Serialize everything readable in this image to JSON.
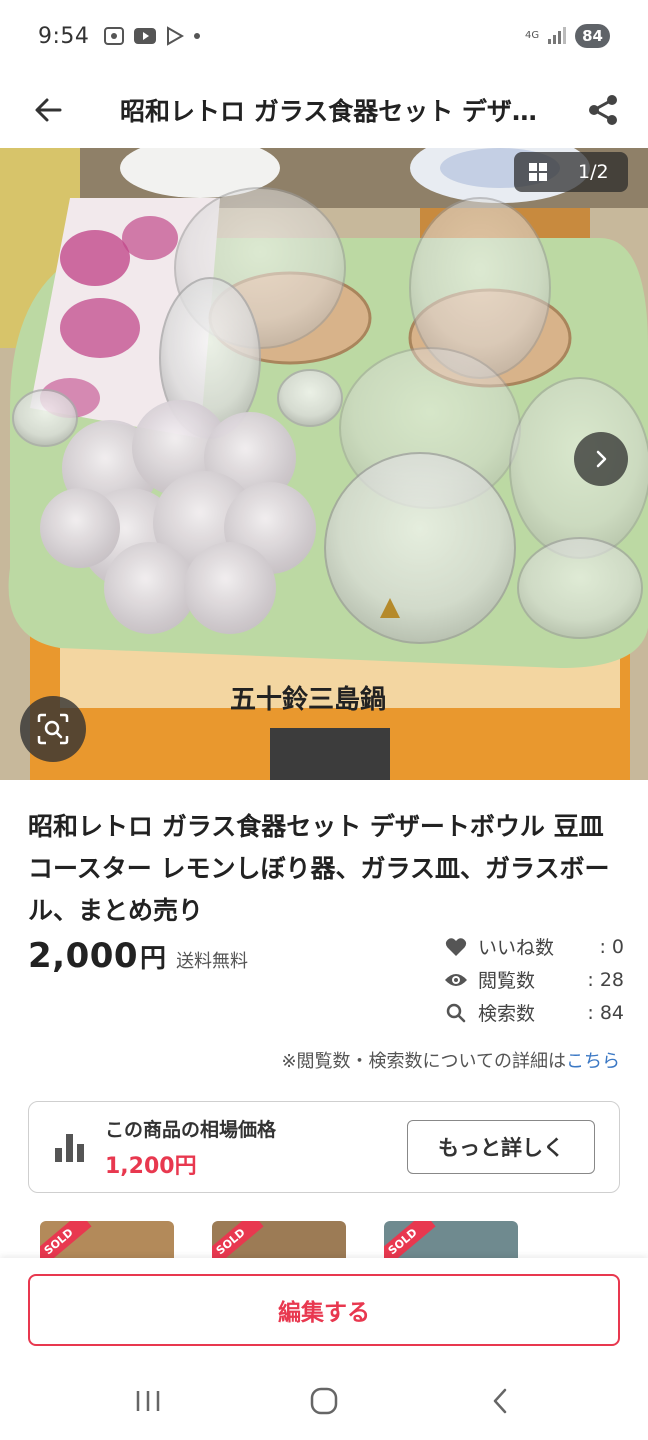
{
  "status_bar": {
    "time": "9:54",
    "network": "4G",
    "battery": "84"
  },
  "header": {
    "title": "昭和レトロ ガラス食器セット デザートボウル 豆皿 コースター レモンしぼり器、ガラス皿、ガラスボール、まとめ売り",
    "back_icon": "arrow-left-icon",
    "share_icon": "share-icon"
  },
  "gallery": {
    "counter": "1/2",
    "box_text": "五十鈴三島鍋"
  },
  "item": {
    "title": "昭和レトロ ガラス食器セット デザートボウル 豆皿 コースター レモンしぼり器、ガラス皿、ガラスボール、まとめ売り",
    "price": "2,000",
    "currency": "円",
    "shipping": "送料無料"
  },
  "stats": [
    {
      "icon": "heart-icon",
      "label": "いいね数",
      "value": ": 0"
    },
    {
      "icon": "eye-icon",
      "label": "閲覧数",
      "value": ": 28"
    },
    {
      "icon": "search-icon",
      "label": "検索数",
      "value": ": 84"
    }
  ],
  "note": {
    "text": "※閲覧数・検索数についての詳細は",
    "link": "こちら"
  },
  "market": {
    "label": "この商品の相場価格",
    "price": "1,200円",
    "button": "もっと詳しく"
  },
  "similar": {
    "badge": "SOLD"
  },
  "bottom": {
    "edit_button": "編集する"
  },
  "colors": {
    "accent": "#e8384f",
    "link": "#3b78c4"
  }
}
